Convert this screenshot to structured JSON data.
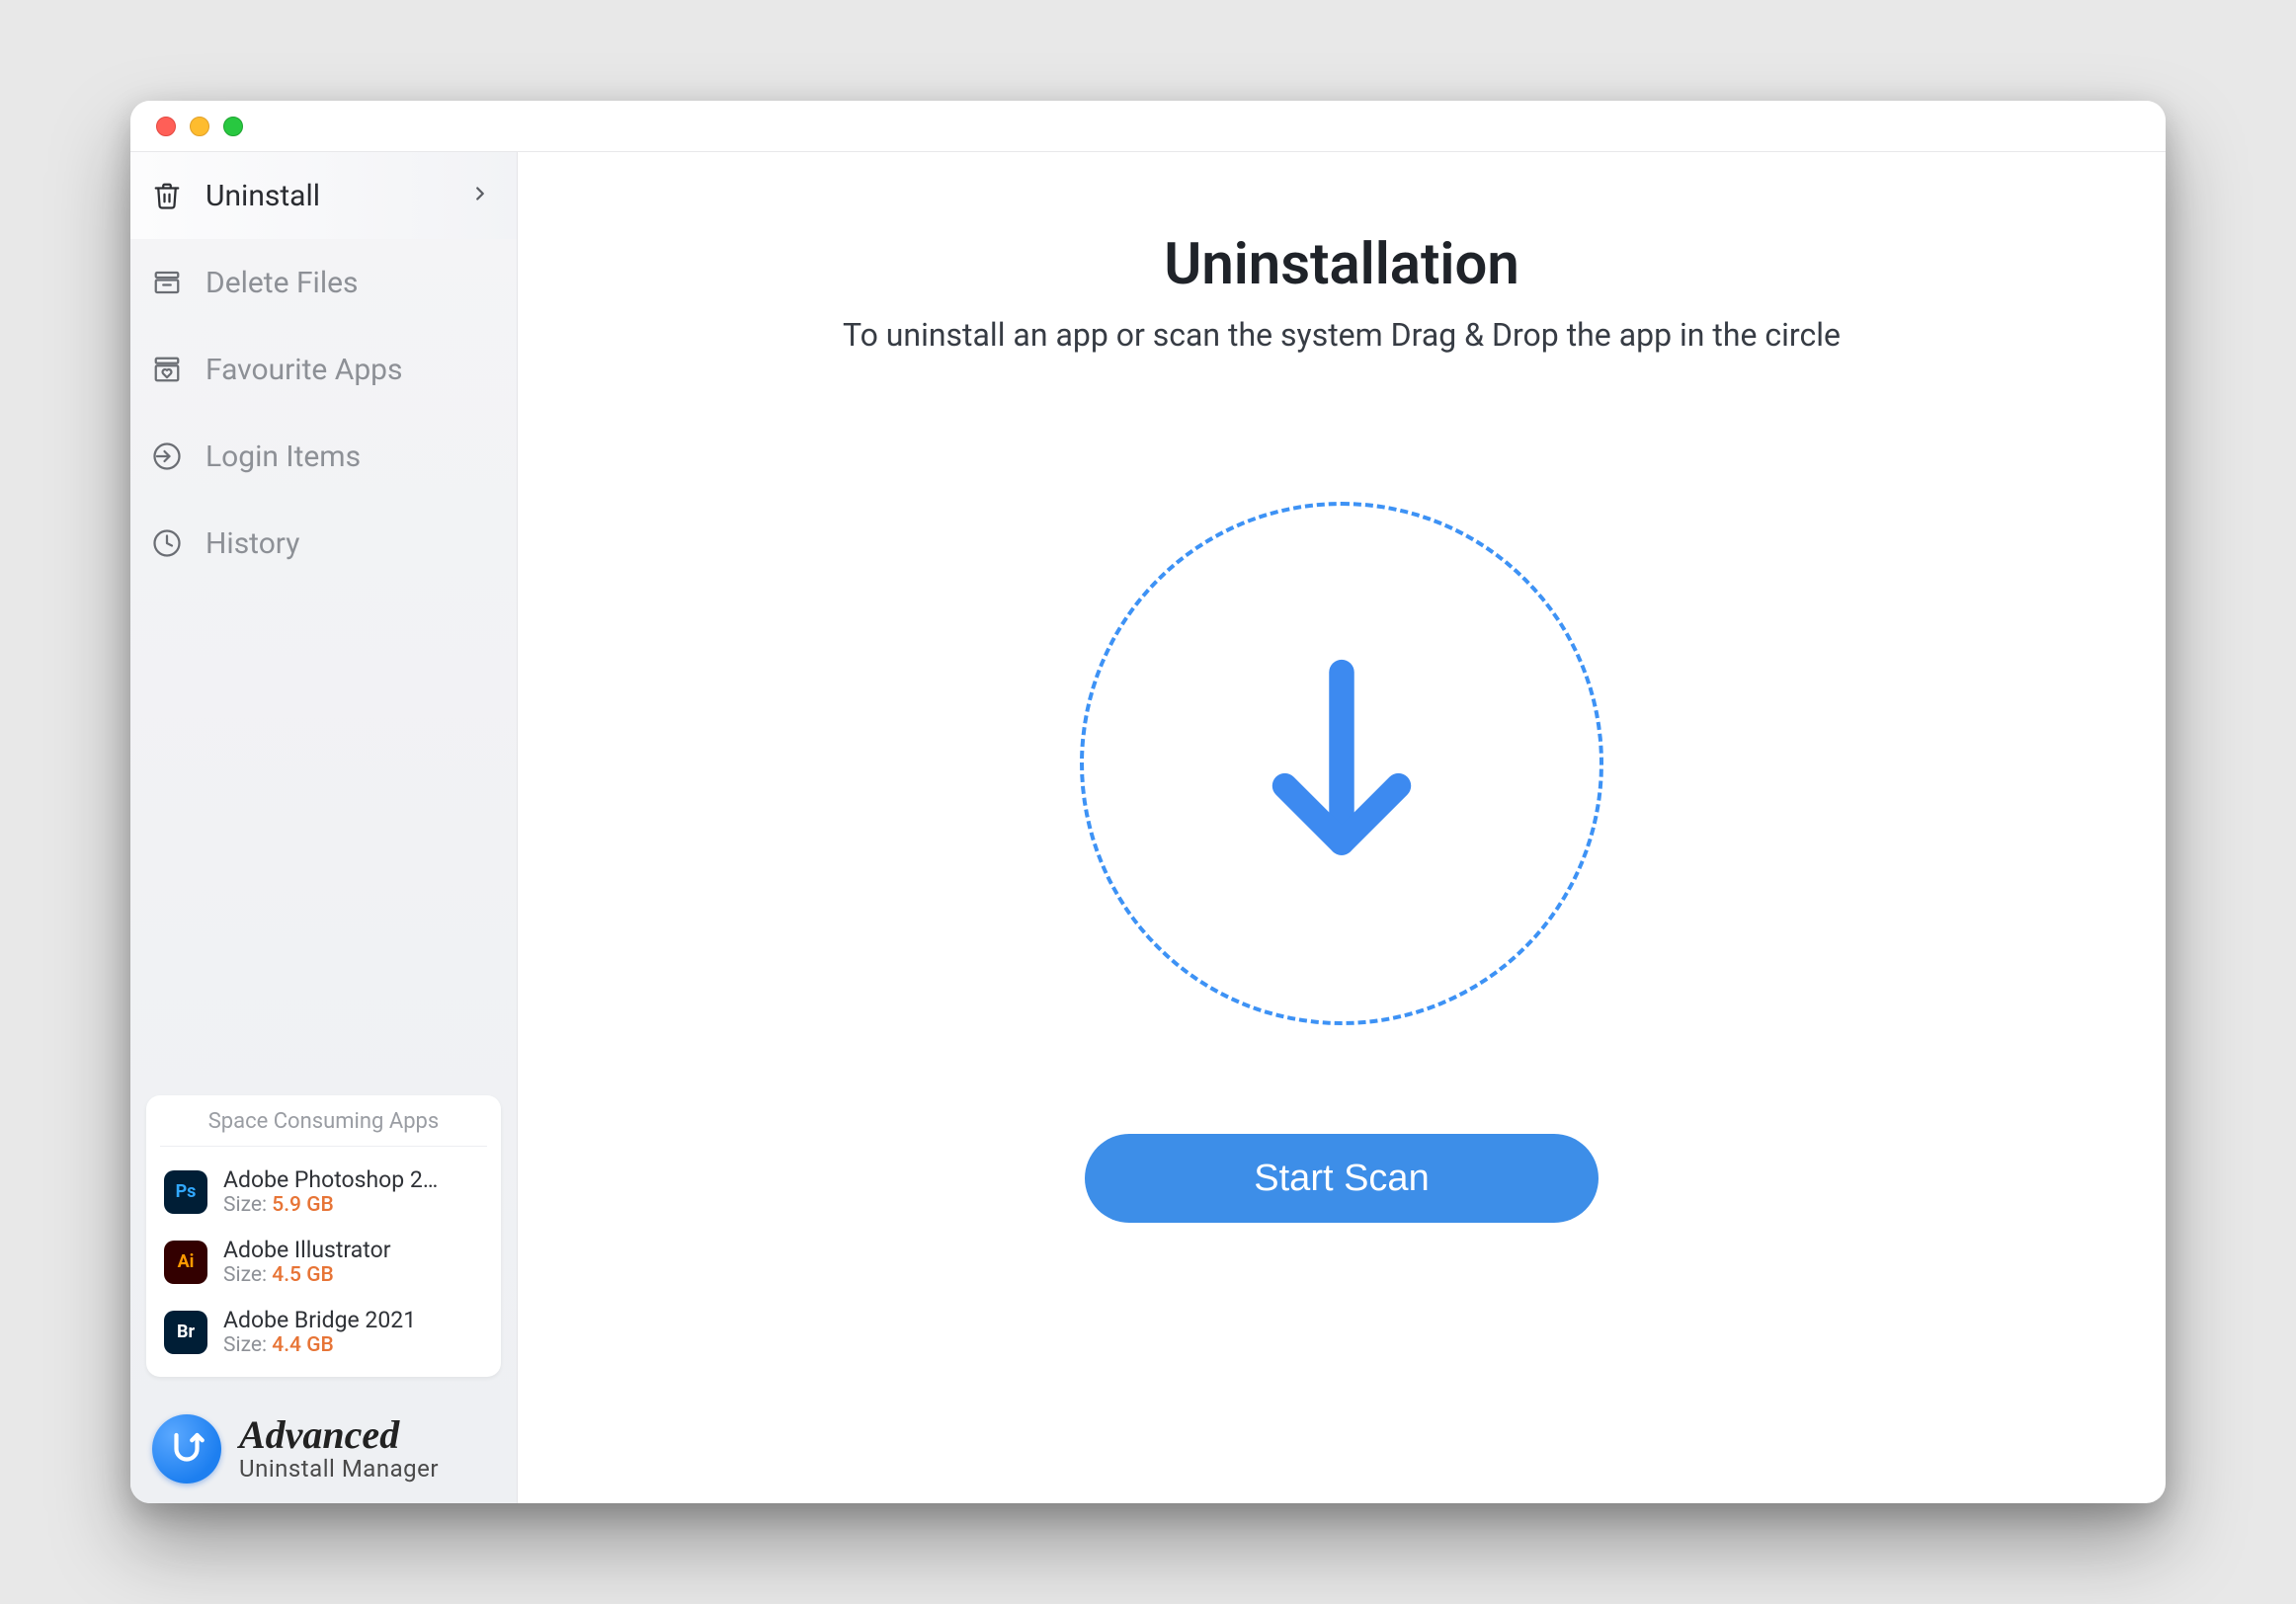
{
  "sidebar": {
    "nav": [
      {
        "label": "Uninstall"
      },
      {
        "label": "Delete Files"
      },
      {
        "label": "Favourite Apps"
      },
      {
        "label": "Login Items"
      },
      {
        "label": "History"
      }
    ],
    "space_panel": {
      "title": "Space Consuming Apps",
      "size_label": "Size:",
      "apps": [
        {
          "name": "Adobe Photoshop 2…",
          "size": "5.9 GB",
          "badge": "Ps"
        },
        {
          "name": "Adobe Illustrator",
          "size": "4.5 GB",
          "badge": "Ai"
        },
        {
          "name": "Adobe Bridge 2021",
          "size": "4.4 GB",
          "badge": "Br"
        }
      ]
    },
    "brand": {
      "top": "Advanced",
      "bottom": "Uninstall Manager"
    }
  },
  "main": {
    "title": "Uninstallation",
    "subtitle": "To uninstall an app or scan the system Drag & Drop the app in the circle",
    "start_button": "Start Scan"
  }
}
